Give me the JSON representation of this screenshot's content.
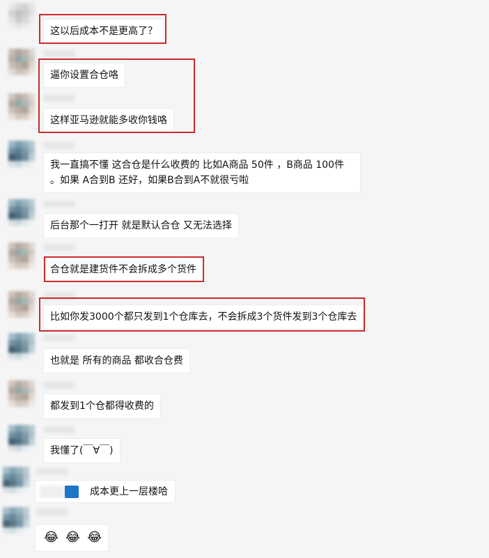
{
  "messages": [
    {
      "text": "这以后成本不是更高了？"
    },
    {
      "text": "逼你设置合仓咯"
    },
    {
      "text": "这样亚马逊就能多收你钱咯"
    },
    {
      "text": "我一直搞不懂 这合仓是什么收费的 比如A商品 50件 ，B商品 100件 。如果 A合到B 还好，如果B合到A不就很亏啦"
    },
    {
      "text": "后台那个一打开 就是默认合仓 又无法选择"
    },
    {
      "text": "合仓就是建货件不会拆成多个货件"
    },
    {
      "text": "比如你发3000个都只发到1个仓库去，不会拆成3个货件发到3个仓库去"
    },
    {
      "text": "也就是 所有的商品 都收合仓费"
    },
    {
      "text": "都发到1个仓都得收费的"
    },
    {
      "text": "我懂了(￣∀￣)"
    },
    {
      "text": "成本更上一层楼哈"
    },
    {
      "emojis": [
        "😂",
        "😂",
        "😂"
      ]
    }
  ],
  "colors": {
    "background": "#f5f5f5",
    "bubble": "#ffffff",
    "highlight": "#cc2a2a"
  }
}
